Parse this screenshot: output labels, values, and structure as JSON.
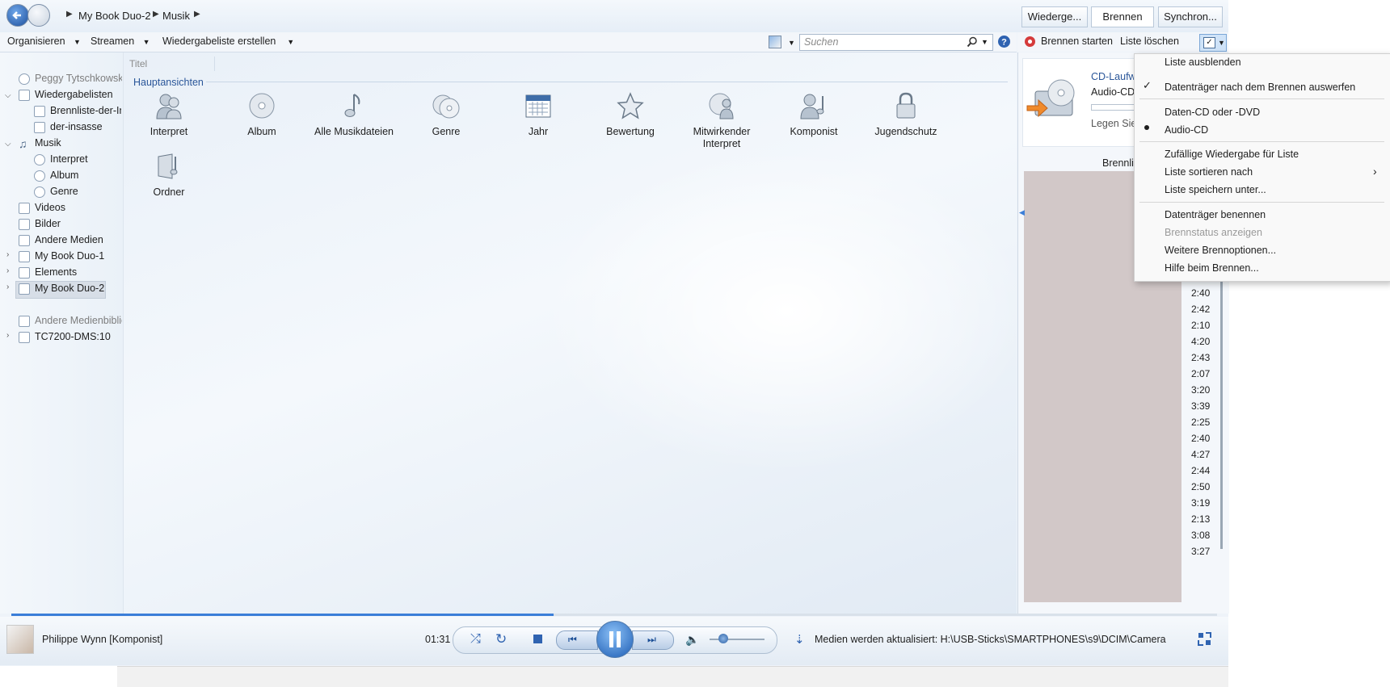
{
  "window": {
    "breadcrumb": [
      "My Book Duo-2",
      "Musik"
    ],
    "tabs": [
      "Wiederge...",
      "Brennen",
      "Synchron..."
    ]
  },
  "toolbar": {
    "organize": "Organisieren",
    "stream": "Streamen",
    "create_playlist": "Wiedergabeliste erstellen",
    "search_placeholder": "Suchen"
  },
  "burn_toolbar": {
    "start": "Brennen starten",
    "clear": "Liste löschen"
  },
  "nav": {
    "user": "Peggy Tytschkowski",
    "playlists": "Wiedergabelisten",
    "playlist_items": [
      "Brennliste-der-In",
      "der-insasse"
    ],
    "music": "Musik",
    "music_items": [
      "Interpret",
      "Album",
      "Genre"
    ],
    "videos": "Videos",
    "pictures": "Bilder",
    "other_media": "Andere Medien",
    "devices": [
      "My Book Duo-1",
      "Elements",
      "My Book Duo-2"
    ],
    "other_libraries": "Andere Medienbiblic",
    "server": "TC7200-DMS:10"
  },
  "main": {
    "column_header": "Titel",
    "section_title": "Hauptansichten",
    "tiles": [
      {
        "label": "Interpret",
        "icon": "artist-icon"
      },
      {
        "label": "Album",
        "icon": "album-icon"
      },
      {
        "label": "Alle Musikdateien",
        "icon": "music-note-icon"
      },
      {
        "label": "Genre",
        "icon": "genre-icon"
      },
      {
        "label": "Jahr",
        "icon": "calendar-icon"
      },
      {
        "label": "Bewertung",
        "icon": "star-icon"
      },
      {
        "label": "Mitwirkender\nInterpret",
        "icon": "contributing-artist-icon"
      },
      {
        "label": "Komponist",
        "icon": "composer-icon"
      },
      {
        "label": "Jugendschutz",
        "icon": "lock-icon"
      },
      {
        "label": "Ordner",
        "icon": "folder-icon"
      }
    ]
  },
  "burn_panel": {
    "drive_title": "CD-Laufw",
    "disc_type": "Audio-CD",
    "insert_text": "Legen Sie",
    "list_label": "Brennli",
    "durations": [
      "2:40",
      "2:42",
      "2:10",
      "4:20",
      "2:43",
      "2:07",
      "3:20",
      "3:39",
      "2:25",
      "2:40",
      "4:27",
      "2:44",
      "2:50",
      "3:19",
      "2:13",
      "3:08",
      "3:27"
    ]
  },
  "menu": {
    "items": [
      {
        "label": "Liste ausblenden"
      },
      {
        "label": "Datenträger nach dem Brennen auswerfen",
        "checked": true
      },
      {
        "label": "Daten-CD oder -DVD"
      },
      {
        "label": "Audio-CD",
        "selected": true
      },
      {
        "label": "Zufällige Wiedergabe für Liste"
      },
      {
        "label": "Liste sortieren nach",
        "submenu": true
      },
      {
        "label": "Liste speichern unter..."
      },
      {
        "label": "Datenträger benennen"
      },
      {
        "label": "Brennstatus anzeigen",
        "disabled": true
      },
      {
        "label": "Weitere Brennoptionen..."
      },
      {
        "label": "Hilfe beim Brennen..."
      }
    ]
  },
  "player": {
    "now_playing": "Philippe Wynn [Komponist]",
    "time": "01:31",
    "progress": 0.45,
    "volume": 0.25,
    "status": "Medien werden aktualisiert: H:\\USB-Sticks\\SMARTPHONES\\s9\\DCIM\\Camera"
  },
  "colors": {
    "accent": "#2a5699",
    "progress": "#3b7ed8",
    "redacted": "#d2c8c8"
  }
}
